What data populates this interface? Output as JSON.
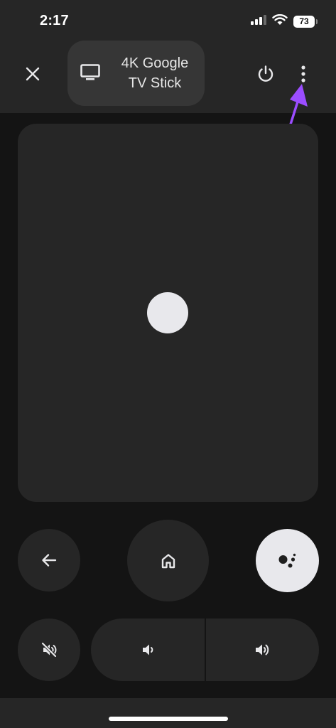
{
  "status_bar": {
    "time": "2:17",
    "battery": "73",
    "icons": [
      "signal-icon",
      "wifi-icon",
      "battery-icon"
    ]
  },
  "header": {
    "close_icon": "close-icon",
    "device_icon": "tv-icon",
    "device_name": "4K Google TV Stick",
    "power_icon": "power-icon",
    "more_icon": "more-vert-icon"
  },
  "annotation": {
    "arrow_color": "#9b4dff"
  },
  "touchpad": {
    "dot_color": "#e8e8ec"
  },
  "controls": {
    "back_icon": "arrow-left-icon",
    "home_icon": "home-icon",
    "assistant_icon": "google-assistant-icon",
    "mute_icon": "volume-off-icon",
    "volume_down_icon": "volume-down-icon",
    "volume_up_icon": "volume-up-icon"
  },
  "colors": {
    "background": "#141414",
    "surface": "#262626",
    "chip": "#363636",
    "icon": "#e8e8ea"
  }
}
